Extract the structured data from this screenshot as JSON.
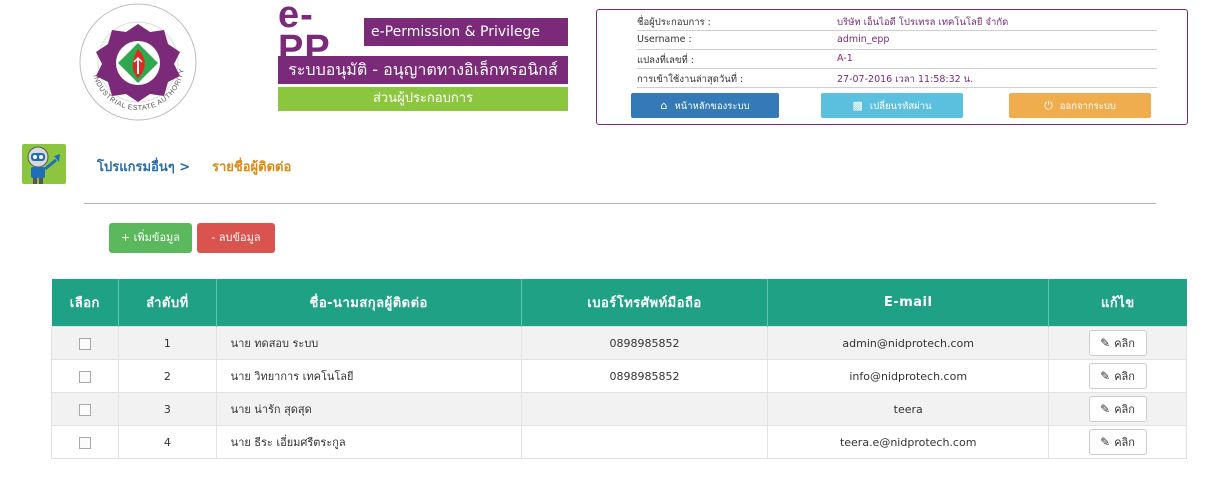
{
  "header": {
    "logo_alt": "INDUSTRIAL ESTATE AUTHORITY OF THAILAND",
    "brand_mark": "e-PP",
    "brand_subtitle": "e-Permission & Privilege",
    "thai_title": "ระบบอนุมัติ - อนุญาตทางอิเล็กทรอนิกส์",
    "section": "ส่วนผู้ประกอบการ"
  },
  "info": {
    "rows": [
      {
        "label": "ชื่อผู้ประกอบการ :",
        "value": "บริษัท เอ็นไอดี โปรเทรล เทคโนโลยี จำกัด"
      },
      {
        "label": "Username :",
        "value": "admin_epp"
      },
      {
        "label": "แปลงที่เลขที่ :",
        "value": "A-1"
      },
      {
        "label": "การเข้าใช้งานล่าสุดวันที่ :",
        "value": "27-07-2016 เวลา 11:58:32 น."
      }
    ],
    "buttons": {
      "home": "หน้าหลักของระบบ",
      "change_password": "เปลี่ยนรหัสผ่าน",
      "logout": "ออกจากระบบ"
    }
  },
  "breadcrumb": {
    "home": "โปรแกรมอื่นๆ >",
    "current": "รายชื่อผู้ติดต่อ"
  },
  "actions": {
    "add": "+ เพิ่มข้อมูล",
    "delete": "- ลบข้อมูล"
  },
  "table": {
    "headers": [
      "เลือก",
      "ลำดับที่",
      "ชื่อ-นามสกุลผู้ติดต่อ",
      "เบอร์โทรศัพท์มือถือ",
      "E-mail",
      "แก้ไข"
    ],
    "rows": [
      {
        "no": "1",
        "name": "นาย ทดสอบ  ระบบ",
        "phone": "0898985852",
        "email": "admin@nidprotech.com"
      },
      {
        "no": "2",
        "name": "นาย วิทยาการ  เทคโนโลยี",
        "phone": "0898985852",
        "email": "info@nidprotech.com"
      },
      {
        "no": "3",
        "name": "นาย น่ารัก  สุดสุด",
        "phone": "",
        "email": "teera"
      },
      {
        "no": "4",
        "name": "นาย ธีระ  เอี่ยมศรีตระกูล",
        "phone": "",
        "email": "teera.e@nidprotech.com"
      }
    ],
    "edit_label": "คลิก"
  },
  "colors": {
    "brand_purple": "#7a2a78",
    "section_green": "#8cc63f",
    "table_header": "#1ea185",
    "home_button": "#337ab7",
    "password_button": "#5bc0de",
    "logout_button": "#f0ad4e",
    "add_button": "#5cb85c",
    "delete_button": "#d9534f"
  }
}
